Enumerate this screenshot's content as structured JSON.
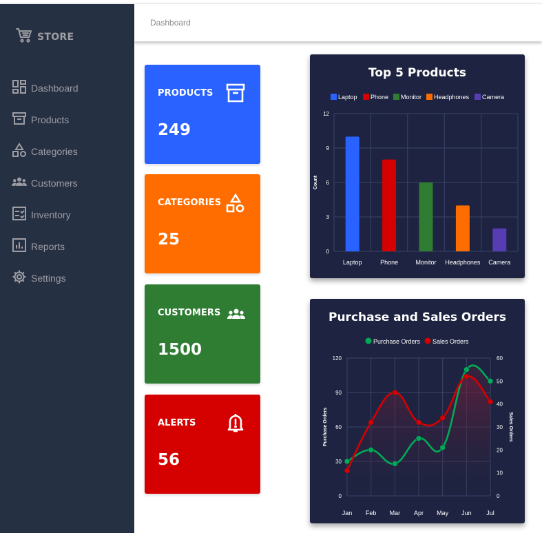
{
  "brand": {
    "label": "STORE",
    "icon": "shopping-cart-icon"
  },
  "sidebar": {
    "items": [
      {
        "label": "Dashboard",
        "icon": "dashboard-icon"
      },
      {
        "label": "Products",
        "icon": "archive-box-icon"
      },
      {
        "label": "Categories",
        "icon": "shapes-icon"
      },
      {
        "label": "Customers",
        "icon": "people-icon"
      },
      {
        "label": "Inventory",
        "icon": "checklist-icon"
      },
      {
        "label": "Reports",
        "icon": "bar-chart-icon"
      },
      {
        "label": "Settings",
        "icon": "gear-icon"
      }
    ]
  },
  "header": {
    "breadcrumb": "Dashboard"
  },
  "cards": [
    {
      "title": "PRODUCTS",
      "value": "249",
      "color": "#2962ff",
      "icon": "archive-box-icon"
    },
    {
      "title": "CATEGORIES",
      "value": "25",
      "color": "#ff6d00",
      "icon": "shapes-icon"
    },
    {
      "title": "CUSTOMERS",
      "value": "1500",
      "color": "#2e7d32",
      "icon": "people-icon"
    },
    {
      "title": "ALERTS",
      "value": "56",
      "color": "#d50000",
      "icon": "bell-alert-icon"
    }
  ],
  "chart_data": [
    {
      "type": "bar",
      "title": "Top 5 Products",
      "categories": [
        "Laptop",
        "Phone",
        "Monitor",
        "Headphones",
        "Camera"
      ],
      "values": [
        10,
        8,
        6,
        4,
        2
      ],
      "colors": [
        "#2962ff",
        "#d50000",
        "#2e7d32",
        "#ff6d00",
        "#583cb3"
      ],
      "legend": [
        "Laptop",
        "Phone",
        "Monitor",
        "Headphones",
        "Camera"
      ],
      "legend_position": "top",
      "ylabel": "Count",
      "yticks": [
        "0",
        "3",
        "6",
        "9",
        "12"
      ],
      "ylim": [
        0,
        12
      ],
      "grid": true
    },
    {
      "type": "line",
      "title": "Purchase and Sales Orders",
      "categories": [
        "Jan",
        "Feb",
        "Mar",
        "Apr",
        "May",
        "Jun",
        "Jul"
      ],
      "series": [
        {
          "name": "Purchase Orders",
          "axis": "left",
          "color": "#00ab57",
          "values": [
            30,
            40,
            28,
            50,
            42,
            110,
            100
          ]
        },
        {
          "name": "Sales Orders",
          "axis": "right",
          "color": "#d50000",
          "values": [
            11,
            32,
            45,
            32,
            34,
            52,
            41
          ]
        }
      ],
      "legend_position": "top",
      "ylabel": "Purchase Orders",
      "y2label": "Sales Orders",
      "yticks": [
        "0",
        "30",
        "60",
        "90",
        "120"
      ],
      "y2ticks": [
        "0",
        "10",
        "20",
        "30",
        "40",
        "50",
        "60"
      ],
      "ylim": [
        0,
        120
      ],
      "y2lim": [
        0,
        60
      ],
      "grid": true
    }
  ]
}
